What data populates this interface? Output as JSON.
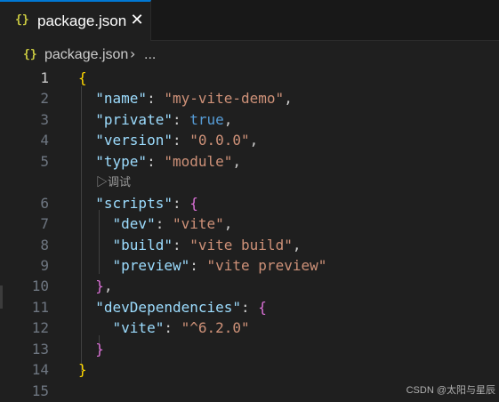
{
  "tab": {
    "icon": "{}",
    "label": "package.json",
    "close_glyph": "✕"
  },
  "breadcrumb": {
    "icon": "{}",
    "file": "package.json",
    "separator": "›",
    "more": "..."
  },
  "codelens": "▷调试",
  "lines": [
    {
      "n": "1",
      "tokens": [
        {
          "t": "{",
          "c": "#ffd700"
        }
      ]
    },
    {
      "n": "2",
      "tokens": [
        {
          "t": "  ",
          "c": "#cccccc"
        },
        {
          "t": "\"name\"",
          "c": "#9cdcfe"
        },
        {
          "t": ": ",
          "c": "#cccccc"
        },
        {
          "t": "\"my-vite-demo\"",
          "c": "#ce9178"
        },
        {
          "t": ",",
          "c": "#cccccc"
        }
      ]
    },
    {
      "n": "3",
      "tokens": [
        {
          "t": "  ",
          "c": "#cccccc"
        },
        {
          "t": "\"private\"",
          "c": "#9cdcfe"
        },
        {
          "t": ": ",
          "c": "#cccccc"
        },
        {
          "t": "true",
          "c": "#569cd6"
        },
        {
          "t": ",",
          "c": "#cccccc"
        }
      ]
    },
    {
      "n": "4",
      "tokens": [
        {
          "t": "  ",
          "c": "#cccccc"
        },
        {
          "t": "\"version\"",
          "c": "#9cdcfe"
        },
        {
          "t": ": ",
          "c": "#cccccc"
        },
        {
          "t": "\"0.0.0\"",
          "c": "#ce9178"
        },
        {
          "t": ",",
          "c": "#cccccc"
        }
      ]
    },
    {
      "n": "5",
      "tokens": [
        {
          "t": "  ",
          "c": "#cccccc"
        },
        {
          "t": "\"type\"",
          "c": "#9cdcfe"
        },
        {
          "t": ": ",
          "c": "#cccccc"
        },
        {
          "t": "\"module\"",
          "c": "#ce9178"
        },
        {
          "t": ",",
          "c": "#cccccc"
        }
      ]
    },
    {
      "n": "6",
      "tokens": [
        {
          "t": "  ",
          "c": "#cccccc"
        },
        {
          "t": "\"scripts\"",
          "c": "#9cdcfe"
        },
        {
          "t": ": ",
          "c": "#cccccc"
        },
        {
          "t": "{",
          "c": "#da70d6"
        }
      ]
    },
    {
      "n": "7",
      "tokens": [
        {
          "t": "    ",
          "c": "#cccccc"
        },
        {
          "t": "\"dev\"",
          "c": "#9cdcfe"
        },
        {
          "t": ": ",
          "c": "#cccccc"
        },
        {
          "t": "\"vite\"",
          "c": "#ce9178"
        },
        {
          "t": ",",
          "c": "#cccccc"
        }
      ]
    },
    {
      "n": "8",
      "tokens": [
        {
          "t": "    ",
          "c": "#cccccc"
        },
        {
          "t": "\"build\"",
          "c": "#9cdcfe"
        },
        {
          "t": ": ",
          "c": "#cccccc"
        },
        {
          "t": "\"vite build\"",
          "c": "#ce9178"
        },
        {
          "t": ",",
          "c": "#cccccc"
        }
      ]
    },
    {
      "n": "9",
      "tokens": [
        {
          "t": "    ",
          "c": "#cccccc"
        },
        {
          "t": "\"preview\"",
          "c": "#9cdcfe"
        },
        {
          "t": ": ",
          "c": "#cccccc"
        },
        {
          "t": "\"vite preview\"",
          "c": "#ce9178"
        }
      ]
    },
    {
      "n": "10",
      "tokens": [
        {
          "t": "  ",
          "c": "#cccccc"
        },
        {
          "t": "}",
          "c": "#da70d6"
        },
        {
          "t": ",",
          "c": "#cccccc"
        }
      ]
    },
    {
      "n": "11",
      "tokens": [
        {
          "t": "  ",
          "c": "#cccccc"
        },
        {
          "t": "\"devDependencies\"",
          "c": "#9cdcfe"
        },
        {
          "t": ": ",
          "c": "#cccccc"
        },
        {
          "t": "{",
          "c": "#da70d6"
        }
      ]
    },
    {
      "n": "12",
      "tokens": [
        {
          "t": "    ",
          "c": "#cccccc"
        },
        {
          "t": "\"vite\"",
          "c": "#9cdcfe"
        },
        {
          "t": ": ",
          "c": "#cccccc"
        },
        {
          "t": "\"^6.2.0\"",
          "c": "#ce9178"
        }
      ]
    },
    {
      "n": "13",
      "tokens": [
        {
          "t": "  ",
          "c": "#cccccc"
        },
        {
          "t": "}",
          "c": "#da70d6"
        }
      ]
    },
    {
      "n": "14",
      "tokens": [
        {
          "t": "}",
          "c": "#ffd700"
        }
      ]
    },
    {
      "n": "15",
      "tokens": []
    }
  ],
  "watermark": "CSDN @太阳与星辰",
  "colors": {
    "accent": "#0078d4",
    "json_icon": "#cbcb41",
    "editor_bg": "#1f1f1f"
  }
}
